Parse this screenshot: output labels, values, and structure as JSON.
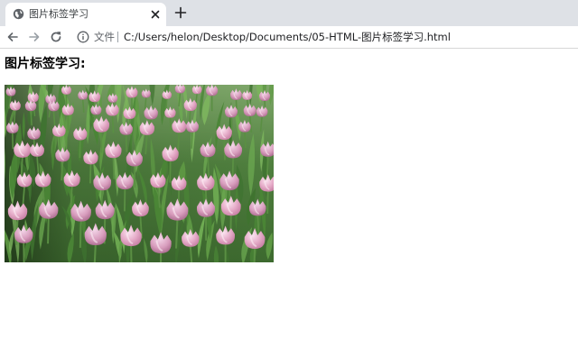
{
  "browser": {
    "tab": {
      "favicon": "globe-icon",
      "title": "图片标签学习",
      "close_icon": "close-icon"
    },
    "new_tab_icon": "plus-icon",
    "toolbar": {
      "back_icon": "arrow-left-icon",
      "forward_icon": "arrow-right-icon",
      "reload_icon": "reload-icon",
      "info_icon": "info-icon",
      "scheme_label": "文件",
      "url": "C:/Users/helon/Desktop/Documents/05-HTML-图片标签学习.html"
    }
  },
  "page": {
    "heading": "图片标签学习:",
    "image": {
      "subject": "pink tulips in a field",
      "colors": {
        "petal": "#e2a9c6",
        "leaf": "#4e8a3c",
        "soil": "#3a2e1f"
      }
    }
  }
}
